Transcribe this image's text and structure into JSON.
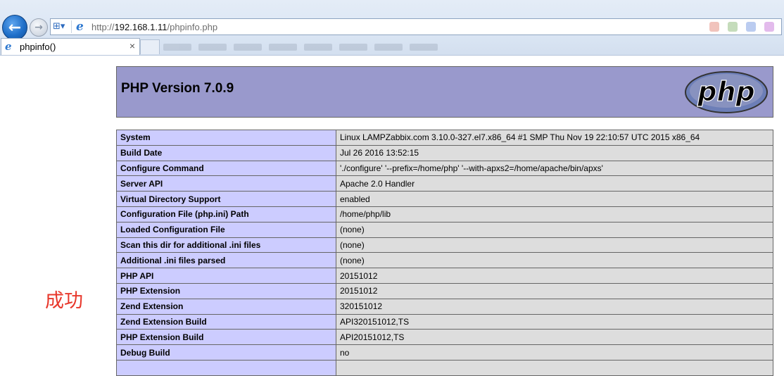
{
  "browser": {
    "address": {
      "prefix": "http://",
      "host": "192.168.1.11",
      "path": "/phpinfo.php"
    },
    "tab": {
      "title": "phpinfo()",
      "close": "×"
    },
    "nav": {
      "back": "←",
      "forward": "→"
    },
    "security_icon": "⊞",
    "ie_logo": "e"
  },
  "page": {
    "title": "PHP Version 7.0.9",
    "logo_text": "php",
    "rows": [
      {
        "key": "System",
        "value": "Linux LAMPZabbix.com 3.10.0-327.el7.x86_64 #1 SMP Thu Nov 19 22:10:57 UTC 2015 x86_64"
      },
      {
        "key": "Build Date",
        "value": "Jul 26 2016 13:52:15"
      },
      {
        "key": "Configure Command",
        "value": "'./configure' '--prefix=/home/php' '--with-apxs2=/home/apache/bin/apxs'"
      },
      {
        "key": "Server API",
        "value": "Apache 2.0 Handler"
      },
      {
        "key": "Virtual Directory Support",
        "value": "enabled"
      },
      {
        "key": "Configuration File (php.ini) Path",
        "value": "/home/php/lib"
      },
      {
        "key": "Loaded Configuration File",
        "value": "(none)"
      },
      {
        "key": "Scan this dir for additional .ini files",
        "value": "(none)"
      },
      {
        "key": "Additional .ini files parsed",
        "value": "(none)"
      },
      {
        "key": "PHP API",
        "value": "20151012"
      },
      {
        "key": "PHP Extension",
        "value": "20151012"
      },
      {
        "key": "Zend Extension",
        "value": "320151012"
      },
      {
        "key": "Zend Extension Build",
        "value": "API320151012,TS"
      },
      {
        "key": "PHP Extension Build",
        "value": "API20151012,TS"
      },
      {
        "key": "Debug Build",
        "value": "no"
      },
      {
        "key": "",
        "value": ""
      }
    ]
  },
  "annotation": "成功",
  "colors": {
    "header_bg": "#9999cc",
    "key_bg": "#ccccff",
    "value_bg": "#dddddd",
    "annotation": "#e8372b"
  }
}
